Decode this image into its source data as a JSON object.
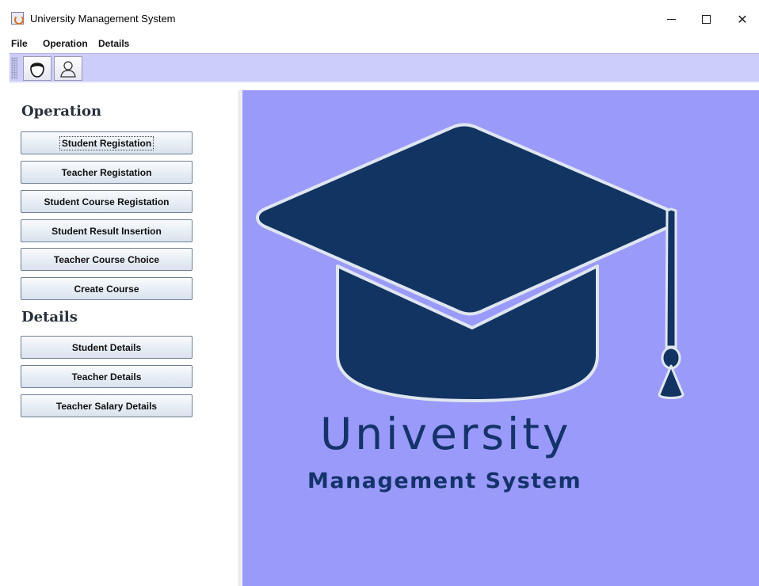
{
  "window": {
    "title": "University Management System",
    "minimize_glyph": "—",
    "maximize_glyph": "☐",
    "close_glyph": "✕"
  },
  "menu": {
    "file": "File",
    "operation": "Operation",
    "details": "Details"
  },
  "toolbar": {
    "buttons": [
      {
        "icon": "student-face-icon"
      },
      {
        "icon": "teacher-user-icon"
      }
    ]
  },
  "sidebar": {
    "operation_heading": "Operation",
    "operation_buttons": [
      "Student Registation",
      "Teacher Registation",
      "Student Course Registation",
      "Student Result Insertion",
      "Teacher Course Choice",
      "Create Course"
    ],
    "details_heading": "Details",
    "details_buttons": [
      "Student Details",
      "Teacher Details",
      "Teacher Salary Details"
    ]
  },
  "main": {
    "logo_title": "University",
    "logo_subtitle": "Management System",
    "background_color": "#9a9afa",
    "logo_color": "#123462"
  }
}
